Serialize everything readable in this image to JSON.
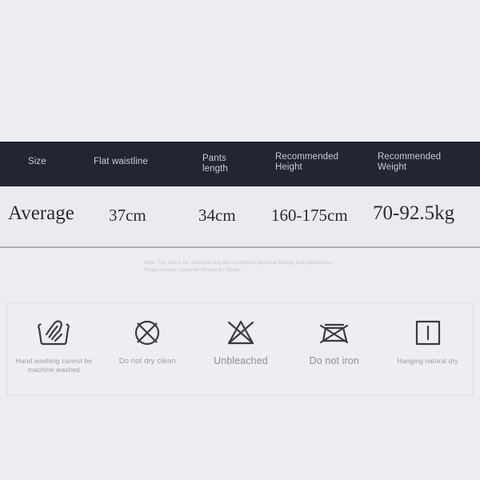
{
  "page": {
    "background_color": "#edecf1",
    "header_band_color": "#232535"
  },
  "size_table": {
    "headers": [
      {
        "label": "Size"
      },
      {
        "label": "Flat waistline"
      },
      {
        "label": "Pants\nlength"
      },
      {
        "label": "Recommended\nHeight"
      },
      {
        "label": "Recommended\nWeight"
      }
    ],
    "rows": [
      {
        "size": "Average",
        "flat_waistline": "37cm",
        "pants_length": "34cm",
        "recommended_height": "160-175cm",
        "recommended_weight": "70-92.5kg"
      }
    ]
  },
  "note": {
    "text": "Note: This size is for reference only due to different personal feelings and preferences. Please contact Customer Service for details."
  },
  "care_instructions": {
    "items": [
      {
        "icon": "hand-wash-icon",
        "label": "Hand washing cannot be\nmachine washed"
      },
      {
        "icon": "do-not-dry-clean-icon",
        "label": "Do not dry clean"
      },
      {
        "icon": "do-not-bleach-icon",
        "label": "Unbleached"
      },
      {
        "icon": "do-not-iron-icon",
        "label": "Do not iron"
      },
      {
        "icon": "hang-dry-icon",
        "label": "Hanging natural dry"
      }
    ]
  }
}
